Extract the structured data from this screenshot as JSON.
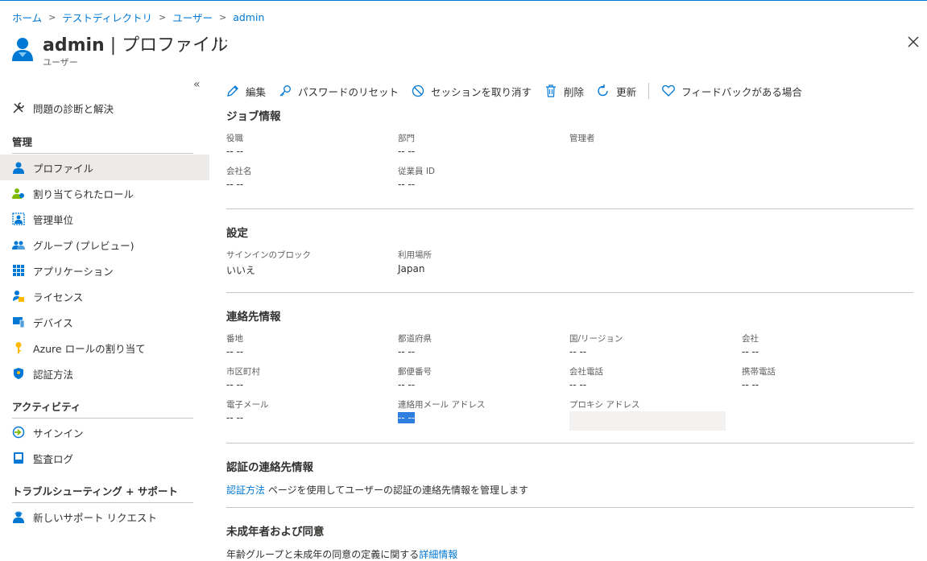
{
  "breadcrumb": [
    "ホーム",
    "テストディレクトリ",
    "ユーザー",
    "admin"
  ],
  "header": {
    "title_main": "admin",
    "title_rest": " | プロファイル",
    "subtitle": "ユーザー",
    "more": "···"
  },
  "sidebar": {
    "collapse": "«",
    "diagnose": "問題の診断と解決",
    "section_manage": "管理",
    "manage_items": [
      "プロファイル",
      "割り当てられたロール",
      "管理単位",
      "グループ (プレビュー)",
      "アプリケーション",
      "ライセンス",
      "デバイス",
      "Azure ロールの割り当て",
      "認証方法"
    ],
    "section_activity": "アクティビティ",
    "activity_items": [
      "サインイン",
      "監査ログ"
    ],
    "section_support": "トラブルシューティング + サポート",
    "support_items": [
      "新しいサポート リクエスト"
    ]
  },
  "toolbar": {
    "edit": "編集",
    "reset_password": "パスワードのリセット",
    "revoke_sessions": "セッションを取り消す",
    "delete": "削除",
    "refresh": "更新",
    "feedback": "フィードバックがある場合"
  },
  "job": {
    "title": "ジョブ情報",
    "job_title_label": "役職",
    "job_title_value": "-- --",
    "department_label": "部門",
    "department_value": "-- --",
    "manager_label": "管理者",
    "company_label": "会社名",
    "company_value": "-- --",
    "employee_id_label": "従業員 ID",
    "employee_id_value": "-- --"
  },
  "settings": {
    "title": "設定",
    "block_label": "サインインのブロック",
    "block_value": "いいえ",
    "location_label": "利用場所",
    "location_value": "Japan"
  },
  "contact": {
    "title": "連絡先情報",
    "street_label": "番地",
    "street_value": "-- --",
    "state_label": "都道府県",
    "state_value": "-- --",
    "country_label": "国/リージョン",
    "country_value": "-- --",
    "office_label": "会社",
    "office_value": "-- --",
    "city_label": "市区町村",
    "city_value": "-- --",
    "zip_label": "郵便番号",
    "zip_value": "-- --",
    "office_phone_label": "会社電話",
    "office_phone_value": "-- --",
    "mobile_label": "携帯電話",
    "mobile_value": "-- --",
    "email_label": "電子メール",
    "email_value": "-- --",
    "alt_email_label": "連絡用メール アドレス",
    "alt_email_value": "-- --",
    "proxy_label": "プロキシ アドレス"
  },
  "auth_contact": {
    "title": "認証の連絡先情報",
    "link": "認証方法",
    "text": " ページを使用してユーザーの認証の連絡先情報を管理します"
  },
  "minor": {
    "title": "未成年者および同意",
    "text": "年齢グループと未成年の同意の定義に関する",
    "link": "詳細情報"
  },
  "colors": {
    "accent": "#0078d4",
    "active_bg": "#edebe9",
    "highlight": "#2f7fe0"
  }
}
